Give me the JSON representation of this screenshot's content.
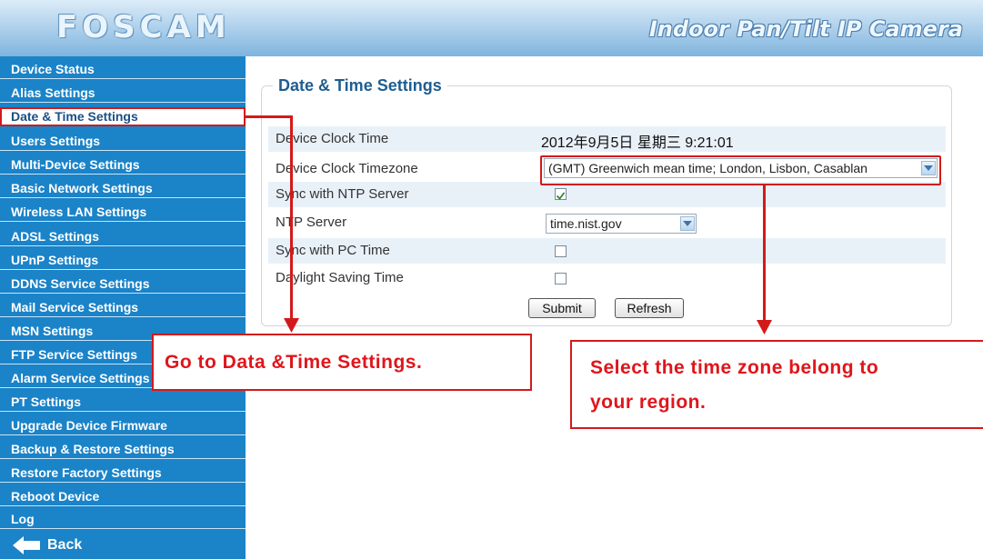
{
  "header": {
    "logo": "FOSCAM",
    "product_title": "Indoor Pan/Tilt IP Camera"
  },
  "sidebar": {
    "items": [
      {
        "label": "Device Status"
      },
      {
        "label": "Alias Settings"
      },
      {
        "label": "Date & Time Settings",
        "active": true
      },
      {
        "label": "Users Settings"
      },
      {
        "label": "Multi-Device Settings"
      },
      {
        "label": "Basic Network Settings"
      },
      {
        "label": "Wireless LAN Settings"
      },
      {
        "label": "ADSL Settings"
      },
      {
        "label": "UPnP Settings"
      },
      {
        "label": "DDNS Service Settings"
      },
      {
        "label": "Mail Service Settings"
      },
      {
        "label": "MSN Settings"
      },
      {
        "label": "FTP Service Settings"
      },
      {
        "label": "Alarm Service Settings"
      },
      {
        "label": "PT Settings"
      },
      {
        "label": "Upgrade Device Firmware"
      },
      {
        "label": "Backup & Restore Settings"
      },
      {
        "label": "Restore Factory Settings"
      },
      {
        "label": "Reboot Device"
      },
      {
        "label": "Log"
      }
    ],
    "back_label": "Back",
    "back_icon": "back-arrow-icon"
  },
  "main": {
    "section_title": "Date & Time Settings",
    "fields": {
      "device_clock_time": {
        "label": "Device Clock Time",
        "value": "2012年9月5日 星期三 9:21:01"
      },
      "device_clock_timezone": {
        "label": "Device Clock Timezone",
        "value": "(GMT) Greenwich mean time; London, Lisbon, Casablan"
      },
      "sync_ntp": {
        "label": "Sync with NTP Server",
        "checked": true
      },
      "ntp_server": {
        "label": "NTP Server",
        "value": "time.nist.gov"
      },
      "sync_pc": {
        "label": "Sync with PC Time",
        "checked": false
      },
      "daylight_saving": {
        "label": "Daylight Saving Time",
        "checked": false
      }
    },
    "submit_label": "Submit",
    "refresh_label": "Refresh"
  },
  "annotations": {
    "callout_left": "Go to Data &Time Settings.",
    "callout_right_line1": "Select the time zone belong to",
    "callout_right_line2": "your region.",
    "color": "#d31a1a"
  },
  "colors": {
    "sidebar_bg": "#1b83c8",
    "row_bg": "#e9f1f8",
    "title_blue": "#1f5d91"
  }
}
